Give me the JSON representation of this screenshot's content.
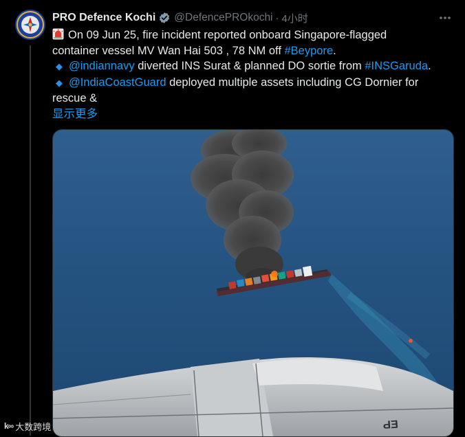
{
  "tweet": {
    "author_name": "PRO Defence Kochi",
    "handle": "@DefencePROkochi",
    "separator": "·",
    "time": "4小时",
    "line1_text": "On 09 Jun 25, fire incident reported onboard Singapore-flagged",
    "line2_text": "container vessel MV Wan Hai 503 , 78 NM off ",
    "hashtag_beypore": "#Beypore",
    "line2_end": ".",
    "bullet_symbol": "◆",
    "mention_navy": "@indiannavy",
    "line3_text": " diverted INS Surat & planned DO sortie from ",
    "hashtag_garuda": "#INSGaruda",
    "line3_end": ".",
    "mention_coastguard": "@IndiaCoastGuard",
    "line4_text": " deployed multiple assets including CG Dornier for",
    "line5_text": "rescue &",
    "show_more": "显示更多",
    "more_icon": "more-horizontal-icon",
    "verified_icon": "verified-badge-icon",
    "siren_icon": "rotating-light-emoji"
  },
  "watermark": {
    "logo": "k∞",
    "text": "大数跨境"
  },
  "colors": {
    "background": "#000000",
    "text": "#e7e9ea",
    "secondary": "#71767b",
    "link": "#1d9bf0",
    "sea": "#234f7d"
  }
}
